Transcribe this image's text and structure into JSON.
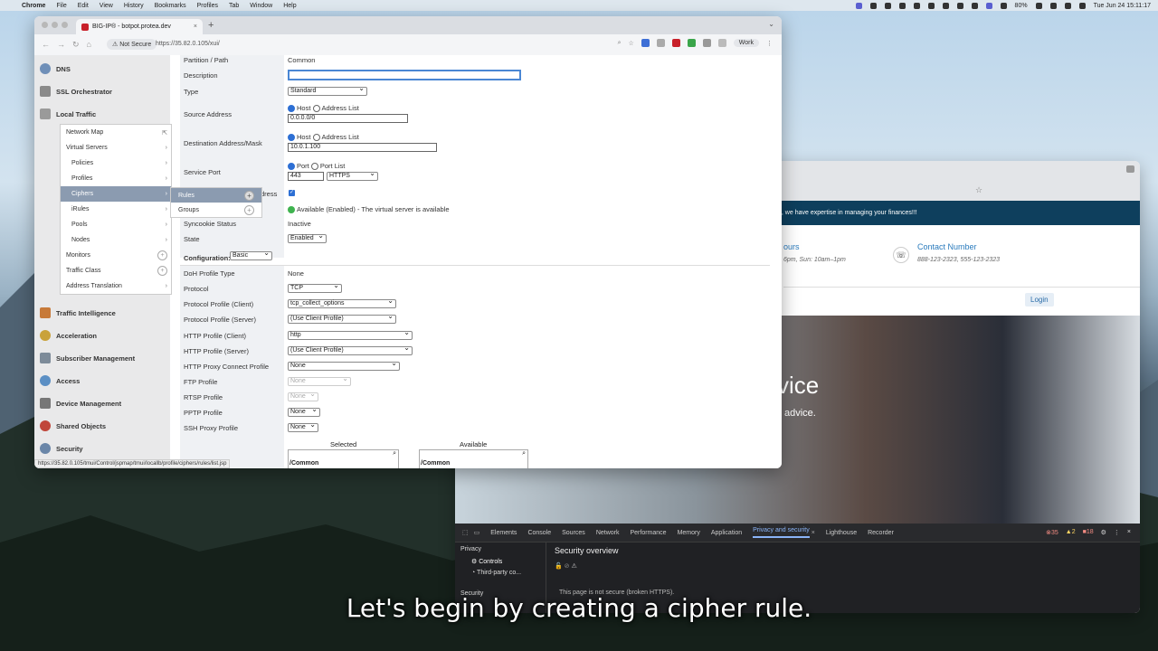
{
  "menubar": {
    "app": "Chrome",
    "items": [
      "File",
      "Edit",
      "View",
      "History",
      "Bookmarks",
      "Profiles",
      "Tab",
      "Window",
      "Help"
    ],
    "battery": "80%",
    "datetime": "Tue Jun 24  15:11:17"
  },
  "browser": {
    "tab_title": "BIG-IP® - botpot.protea.dev",
    "not_secure": "Not Secure",
    "url": "https://35.82.0.105/xui/",
    "profile": "Work",
    "status_url": "https://35.82.0.105/tmui/Control/jspmap/tmui/locallb/profile/ciphers/rules/list.jsp"
  },
  "sidebar": {
    "items": [
      "DNS",
      "SSL Orchestrator",
      "Local Traffic",
      "Traffic Intelligence",
      "Acceleration",
      "Subscriber Management",
      "Access",
      "Device Management",
      "Shared Objects",
      "Security"
    ],
    "submenu": [
      "Network Map",
      "Virtual Servers",
      "Policies",
      "Profiles",
      "Ciphers",
      "iRules",
      "Pools",
      "Nodes",
      "Monitors",
      "Traffic Class",
      "Address Translation"
    ],
    "flyout": [
      "Rules",
      "Groups"
    ]
  },
  "form": {
    "partition_label": "Partition / Path",
    "partition_value": "Common",
    "description_label": "Description",
    "type_label": "Type",
    "type_value": "Standard",
    "source_label": "Source Address",
    "host": "Host",
    "address_list": "Address List",
    "source_value": "0.0.0.0/0",
    "dest_label": "Destination Address/Mask",
    "dest_value": "10.0.1.100",
    "port_label": "Service Port",
    "port": "Port",
    "port_list": "Port List",
    "port_value": "443",
    "port_proto": "HTTPS",
    "notify_label_tail": "dress",
    "availability_value": "Available (Enabled) - The virtual server is available",
    "syncookie_label": "Syncookie Status",
    "syncookie_value": "Inactive",
    "state_label": "State",
    "state_value": "Enabled",
    "config_label": "Configuration:",
    "config_value": "Basic",
    "doh_label": "DoH Profile Type",
    "doh_value": "None",
    "protocol_label": "Protocol",
    "protocol_value": "TCP",
    "ppc_label": "Protocol Profile (Client)",
    "ppc_value": "tcp_collect_options",
    "pps_label": "Protocol Profile (Server)",
    "pps_value": "(Use Client Profile)",
    "hpc_label": "HTTP Profile (Client)",
    "hpc_value": "http",
    "hps_label": "HTTP Profile (Server)",
    "hps_value": "(Use Client Profile)",
    "hpcp_label": "HTTP Proxy Connect Profile",
    "hpcp_value": "None",
    "ftp_label": "FTP Profile",
    "ftp_value": "None",
    "rtsp_label": "RTSP Profile",
    "rtsp_value": "None",
    "pptp_label": "PPTP Profile",
    "pptp_value": "None",
    "ssh_label": "SSH Proxy Profile",
    "ssh_value": "None",
    "selected": "Selected",
    "available": "Available",
    "common": "/Common"
  },
  "site": {
    "banner": "Welcome to Arcadia Finance website, we have expertise in managing your finances!!!",
    "hours_tail": "ours",
    "hours_detail": "6pm, Sun: 10am–1pm",
    "contact_title": "Contact Number",
    "contact_value": "888-123-2323, 555-123-2323",
    "login": "Login",
    "hero_title": "vice",
    "hero_sub": "advice."
  },
  "devtools": {
    "tabs": [
      "Elements",
      "Console",
      "Sources",
      "Network",
      "Performance",
      "Memory",
      "Application",
      "Privacy and security",
      "Lighthouse",
      "Recorder"
    ],
    "errors": "35",
    "warnings": "2",
    "issues": "18",
    "privacy": "Privacy",
    "controls": "Controls",
    "third_party": "Third-party co...",
    "security": "Security",
    "overview": "Security overview",
    "not_secure_msg": "This page is not secure (broken HTTPS)."
  },
  "caption": "Let's begin by creating a cipher rule."
}
